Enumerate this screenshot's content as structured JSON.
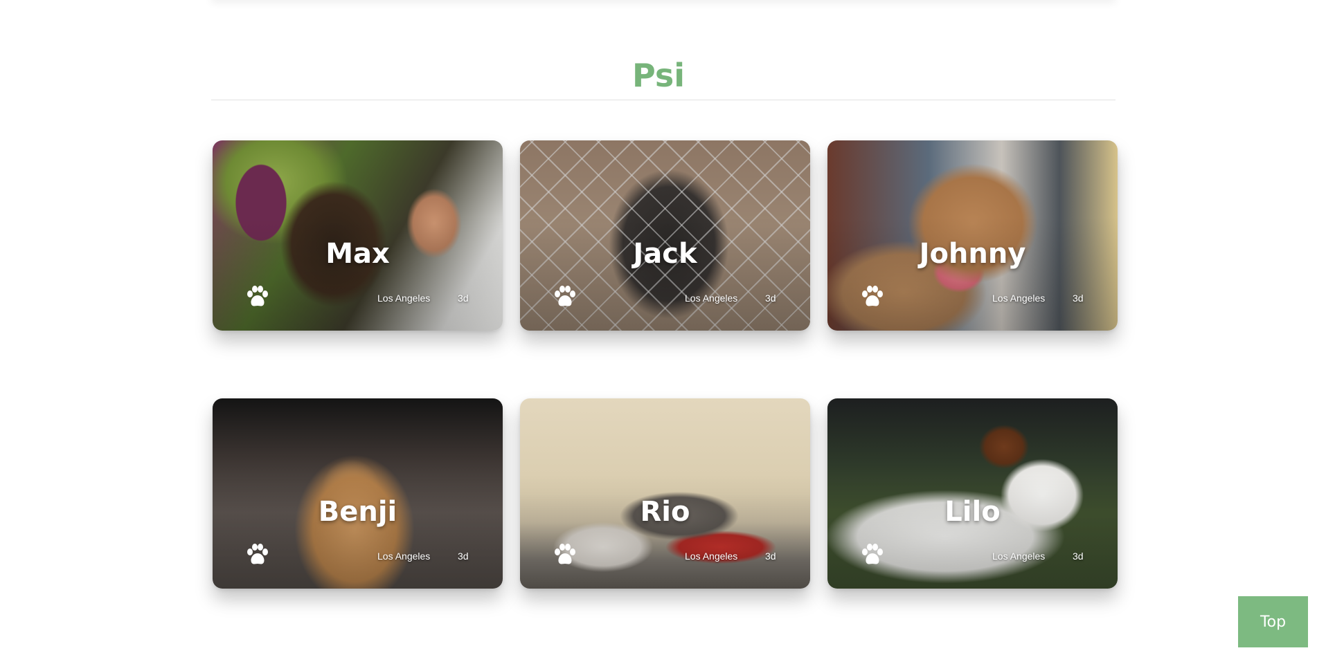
{
  "section": {
    "title": "Psi"
  },
  "cards": [
    {
      "name": "Max",
      "location": "Los Angeles",
      "age": "3d",
      "icon": "paw-icon"
    },
    {
      "name": "Jack",
      "location": "Los Angeles",
      "age": "3d",
      "icon": "paw-icon"
    },
    {
      "name": "Johnny",
      "location": "Los Angeles",
      "age": "3d",
      "icon": "paw-icon"
    },
    {
      "name": "Benji",
      "location": "Los Angeles",
      "age": "3d",
      "icon": "paw-icon"
    },
    {
      "name": "Rio",
      "location": "Los Angeles",
      "age": "3d",
      "icon": "paw-icon"
    },
    {
      "name": "Lilo",
      "location": "Los Angeles",
      "age": "3d",
      "icon": "paw-icon"
    }
  ],
  "top_button": {
    "label": "Top"
  },
  "colors": {
    "accent": "#77b47a",
    "button": "#7dba81",
    "text_on_card": "#ffffff"
  }
}
